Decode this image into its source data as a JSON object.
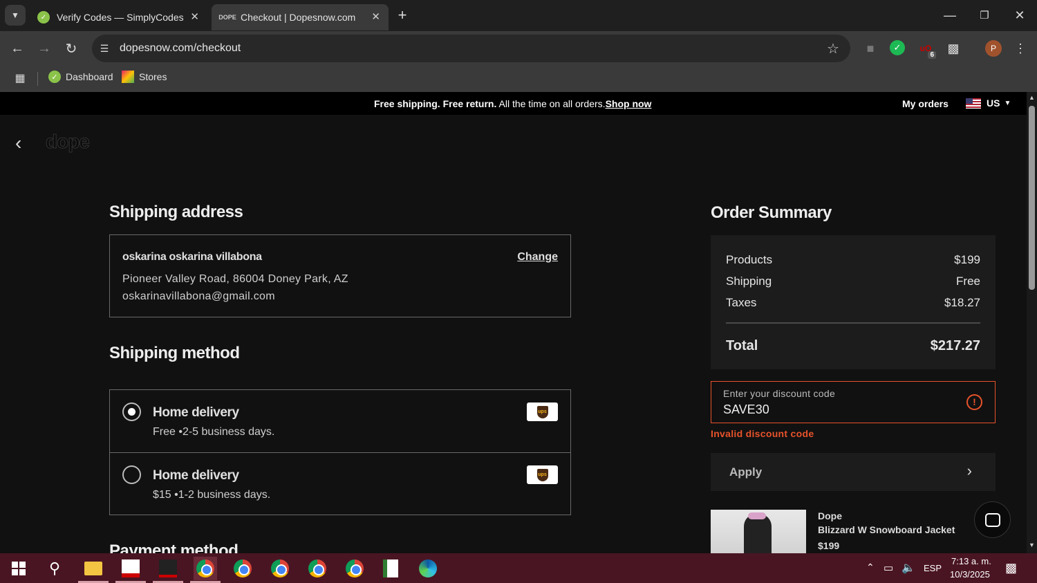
{
  "browser": {
    "tabs": [
      {
        "title": "Verify Codes — SimplyCodes",
        "active": false
      },
      {
        "title": "Checkout | Dopesnow.com",
        "active": true
      }
    ],
    "url": "dopesnow.com/checkout",
    "bookmarks": [
      {
        "label": "Dashboard"
      },
      {
        "label": "Stores"
      }
    ],
    "extension_badge": "6",
    "profile_initial": "P"
  },
  "site": {
    "promo_bold": "Free shipping. Free return.",
    "promo_regular": " All the time on all orders.",
    "promo_link": "Shop now",
    "my_orders": "My orders",
    "region": "US",
    "logo": "dope"
  },
  "shipping_address": {
    "heading": "Shipping address",
    "name": "oskarina oskarina villabona",
    "change_label": "Change",
    "address": "Pioneer Valley Road, 86004 Doney Park, AZ",
    "email": "oskarinavillabona@gmail.com"
  },
  "shipping_method": {
    "heading": "Shipping method",
    "options": [
      {
        "title": "Home delivery",
        "detail": "Free •2-5 business days.",
        "selected": true,
        "carrier": "UPS"
      },
      {
        "title": "Home delivery",
        "detail": "$15 •1-2 business days.",
        "selected": false,
        "carrier": "UPS"
      }
    ]
  },
  "payment": {
    "heading": "Payment method"
  },
  "order_summary": {
    "heading": "Order Summary",
    "rows": [
      {
        "label": "Products",
        "value": "$199"
      },
      {
        "label": "Shipping",
        "value": "Free"
      },
      {
        "label": "Taxes",
        "value": "$18.27"
      }
    ],
    "total_label": "Total",
    "total_value": "$217.27",
    "discount_label": "Enter your discount code",
    "discount_value": "SAVE30",
    "discount_error": "Invalid discount code",
    "apply_label": "Apply",
    "product": {
      "brand": "Dope",
      "name": "Blizzard W Snowboard Jacket",
      "price": "$199"
    }
  },
  "taskbar": {
    "language": "ESP",
    "time": "7:13 a. m.",
    "date": "10/3/2025"
  },
  "colors": {
    "error": "#e8532b",
    "page_bg": "#111111",
    "taskbar": "#4a1523"
  }
}
